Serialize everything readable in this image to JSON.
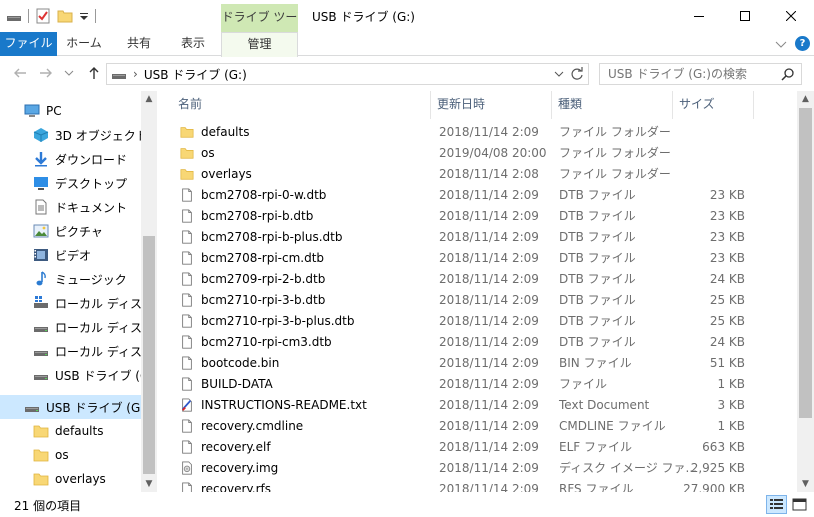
{
  "titlebar": {
    "context_tab": "ドライブ ツール",
    "title": "USB ドライブ (G:)"
  },
  "ribbon": {
    "tabs": [
      {
        "label": "ファイル"
      },
      {
        "label": "ホーム"
      },
      {
        "label": "共有"
      },
      {
        "label": "表示"
      },
      {
        "label": "管理"
      }
    ]
  },
  "address": {
    "path": "USB ドライブ (G:)",
    "search_placeholder": "USB ドライブ (G:)の検索"
  },
  "nav": {
    "items": [
      {
        "label": "PC",
        "icon": "pc-icon"
      },
      {
        "label": "3D オブジェクト",
        "icon": "3d-objects-icon"
      },
      {
        "label": "ダウンロード",
        "icon": "download-icon"
      },
      {
        "label": "デスクトップ",
        "icon": "desktop-icon"
      },
      {
        "label": "ドキュメント",
        "icon": "document-icon"
      },
      {
        "label": "ピクチャ",
        "icon": "pictures-icon"
      },
      {
        "label": "ビデオ",
        "icon": "video-icon"
      },
      {
        "label": "ミュージック",
        "icon": "music-icon"
      },
      {
        "label": "ローカル ディスク (C",
        "icon": "local-disk-icon"
      },
      {
        "label": "ローカル ディスク (D",
        "icon": "drive-icon"
      },
      {
        "label": "ローカル ディスク (E",
        "icon": "drive-icon"
      },
      {
        "label": "USB ドライブ (G:)",
        "icon": "usb-drive-icon"
      },
      {
        "label": "USB ドライブ (G:)",
        "icon": "usb-drive-icon"
      },
      {
        "label": "defaults",
        "icon": "folder-icon"
      },
      {
        "label": "os",
        "icon": "folder-icon"
      },
      {
        "label": "overlays",
        "icon": "folder-icon"
      }
    ]
  },
  "columns": {
    "name": "名前",
    "date": "更新日時",
    "type": "種類",
    "size": "サイズ"
  },
  "files": [
    {
      "name": "defaults",
      "date": "2018/11/14 2:09",
      "type": "ファイル フォルダー",
      "size": "",
      "icon": "folder-icon"
    },
    {
      "name": "os",
      "date": "2019/04/08 20:00",
      "type": "ファイル フォルダー",
      "size": "",
      "icon": "folder-icon"
    },
    {
      "name": "overlays",
      "date": "2018/11/14 2:08",
      "type": "ファイル フォルダー",
      "size": "",
      "icon": "folder-icon"
    },
    {
      "name": "bcm2708-rpi-0-w.dtb",
      "date": "2018/11/14 2:09",
      "type": "DTB ファイル",
      "size": "23 KB",
      "icon": "file-icon"
    },
    {
      "name": "bcm2708-rpi-b.dtb",
      "date": "2018/11/14 2:09",
      "type": "DTB ファイル",
      "size": "23 KB",
      "icon": "file-icon"
    },
    {
      "name": "bcm2708-rpi-b-plus.dtb",
      "date": "2018/11/14 2:09",
      "type": "DTB ファイル",
      "size": "23 KB",
      "icon": "file-icon"
    },
    {
      "name": "bcm2708-rpi-cm.dtb",
      "date": "2018/11/14 2:09",
      "type": "DTB ファイル",
      "size": "23 KB",
      "icon": "file-icon"
    },
    {
      "name": "bcm2709-rpi-2-b.dtb",
      "date": "2018/11/14 2:09",
      "type": "DTB ファイル",
      "size": "24 KB",
      "icon": "file-icon"
    },
    {
      "name": "bcm2710-rpi-3-b.dtb",
      "date": "2018/11/14 2:09",
      "type": "DTB ファイル",
      "size": "25 KB",
      "icon": "file-icon"
    },
    {
      "name": "bcm2710-rpi-3-b-plus.dtb",
      "date": "2018/11/14 2:09",
      "type": "DTB ファイル",
      "size": "25 KB",
      "icon": "file-icon"
    },
    {
      "name": "bcm2710-rpi-cm3.dtb",
      "date": "2018/11/14 2:09",
      "type": "DTB ファイル",
      "size": "24 KB",
      "icon": "file-icon"
    },
    {
      "name": "bootcode.bin",
      "date": "2018/11/14 2:09",
      "type": "BIN ファイル",
      "size": "51 KB",
      "icon": "file-icon"
    },
    {
      "name": "BUILD-DATA",
      "date": "2018/11/14 2:09",
      "type": "ファイル",
      "size": "1 KB",
      "icon": "file-icon"
    },
    {
      "name": "INSTRUCTIONS-README.txt",
      "date": "2018/11/14 2:09",
      "type": "Text Document",
      "size": "3 KB",
      "icon": "text-document-icon"
    },
    {
      "name": "recovery.cmdline",
      "date": "2018/11/14 2:09",
      "type": "CMDLINE ファイル",
      "size": "1 KB",
      "icon": "file-icon"
    },
    {
      "name": "recovery.elf",
      "date": "2018/11/14 2:09",
      "type": "ELF ファイル",
      "size": "663 KB",
      "icon": "file-icon"
    },
    {
      "name": "recovery.img",
      "date": "2018/11/14 2:09",
      "type": "ディスク イメージ ファ...",
      "size": "2,925 KB",
      "icon": "disk-image-icon"
    },
    {
      "name": "recovery.rfs",
      "date": "2018/11/14 2:09",
      "type": "RFS ファイル",
      "size": "27,900 KB",
      "icon": "file-icon"
    }
  ],
  "status": {
    "item_count": "21 個の項目"
  }
}
